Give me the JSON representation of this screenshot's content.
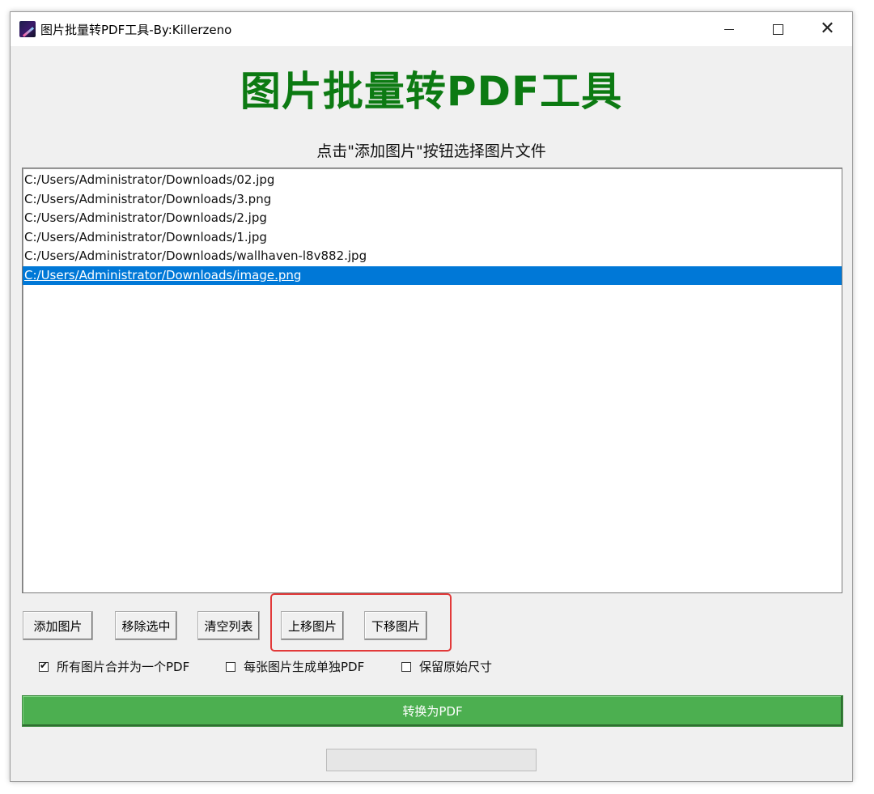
{
  "window": {
    "title": "图片批量转PDF工具-By:Killerzeno"
  },
  "main": {
    "heading": "图片批量转PDF工具",
    "hint": "点击\"添加图片\"按钮选择图片文件"
  },
  "file_list": {
    "items": [
      "C:/Users/Administrator/Downloads/02.jpg",
      "C:/Users/Administrator/Downloads/3.png",
      "C:/Users/Administrator/Downloads/2.jpg",
      "C:/Users/Administrator/Downloads/1.jpg",
      "C:/Users/Administrator/Downloads/wallhaven-l8v882.jpg",
      "C:/Users/Administrator/Downloads/image.png"
    ],
    "selected_index": 5
  },
  "buttons": {
    "add": "添加图片",
    "remove": "移除选中",
    "clear": "清空列表",
    "move_up": "上移图片",
    "move_down": "下移图片"
  },
  "options": {
    "merge_label": "所有图片合并为一个PDF",
    "merge_checked": true,
    "separate_label": "每张图片生成单独PDF",
    "separate_checked": false,
    "keep_size_label": "保留原始尺寸",
    "keep_size_checked": false
  },
  "convert": {
    "label": "转换为PDF"
  },
  "progress": {
    "value": 0
  },
  "colors": {
    "heading": "#0c7a12",
    "convert_button": "#4caf50",
    "selection": "#0078d7",
    "highlight_annotation": "#e23a3a"
  }
}
